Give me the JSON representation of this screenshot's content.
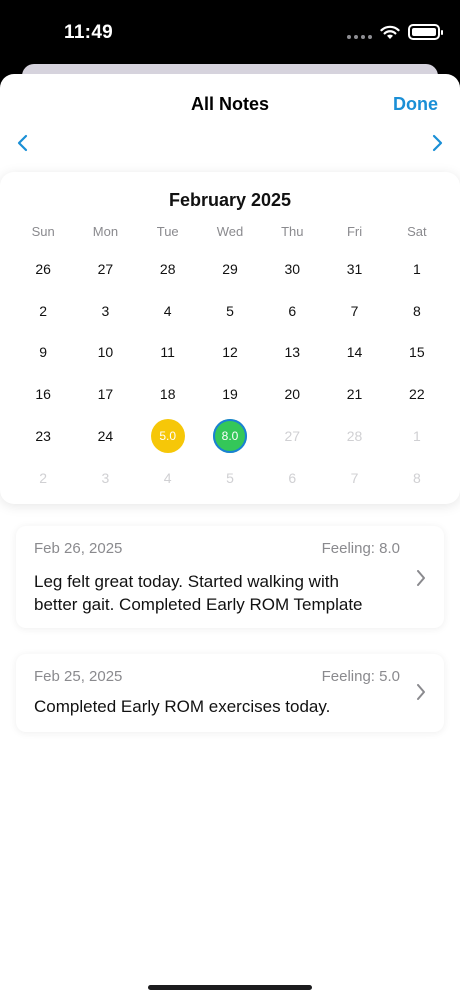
{
  "status_bar": {
    "time": "11:49"
  },
  "header": {
    "title": "All Notes",
    "done_label": "Done"
  },
  "calendar": {
    "month_title": "February 2025",
    "weekdays": [
      "Sun",
      "Mon",
      "Tue",
      "Wed",
      "Thu",
      "Fri",
      "Sat"
    ],
    "days": [
      {
        "label": "26",
        "muted": false
      },
      {
        "label": "27",
        "muted": false
      },
      {
        "label": "28",
        "muted": false
      },
      {
        "label": "29",
        "muted": false
      },
      {
        "label": "30",
        "muted": false
      },
      {
        "label": "31",
        "muted": false
      },
      {
        "label": "1",
        "muted": false
      },
      {
        "label": "2",
        "muted": false
      },
      {
        "label": "3",
        "muted": false
      },
      {
        "label": "4",
        "muted": false
      },
      {
        "label": "5",
        "muted": false
      },
      {
        "label": "6",
        "muted": false
      },
      {
        "label": "7",
        "muted": false
      },
      {
        "label": "8",
        "muted": false
      },
      {
        "label": "9",
        "muted": false
      },
      {
        "label": "10",
        "muted": false
      },
      {
        "label": "11",
        "muted": false
      },
      {
        "label": "12",
        "muted": false
      },
      {
        "label": "13",
        "muted": false
      },
      {
        "label": "14",
        "muted": false
      },
      {
        "label": "15",
        "muted": false
      },
      {
        "label": "16",
        "muted": false
      },
      {
        "label": "17",
        "muted": false
      },
      {
        "label": "18",
        "muted": false
      },
      {
        "label": "19",
        "muted": false
      },
      {
        "label": "20",
        "muted": false
      },
      {
        "label": "21",
        "muted": false
      },
      {
        "label": "22",
        "muted": false
      },
      {
        "label": "23",
        "muted": false
      },
      {
        "label": "24",
        "muted": false
      },
      {
        "label": "5.0",
        "muted": false,
        "badge": "#f6c708"
      },
      {
        "label": "8.0",
        "muted": false,
        "badge": "#34c759",
        "ring": "#1a7fd6"
      },
      {
        "label": "27",
        "muted": true
      },
      {
        "label": "28",
        "muted": true
      },
      {
        "label": "1",
        "muted": true
      },
      {
        "label": "2",
        "muted": true
      },
      {
        "label": "3",
        "muted": true
      },
      {
        "label": "4",
        "muted": true
      },
      {
        "label": "5",
        "muted": true
      },
      {
        "label": "6",
        "muted": true
      },
      {
        "label": "7",
        "muted": true
      },
      {
        "label": "8",
        "muted": true
      }
    ]
  },
  "notes": [
    {
      "date": "Feb 26, 2025",
      "feeling": "Feeling: 8.0",
      "line1": "Leg felt great today. Started walking with",
      "line2": "better gait. Completed Early ROM Template"
    },
    {
      "date": "Feb 25, 2025",
      "feeling": "Feeling: 5.0",
      "line1": "Completed Early ROM exercises today."
    }
  ],
  "colors": {
    "accent": "#1a8fd6",
    "badge_yellow": "#f6c708",
    "badge_green": "#34c759"
  },
  "icons": {
    "nav_prev": "chevron-left-icon",
    "nav_next": "chevron-right-icon",
    "note_disclosure": "chevron-right-icon"
  }
}
